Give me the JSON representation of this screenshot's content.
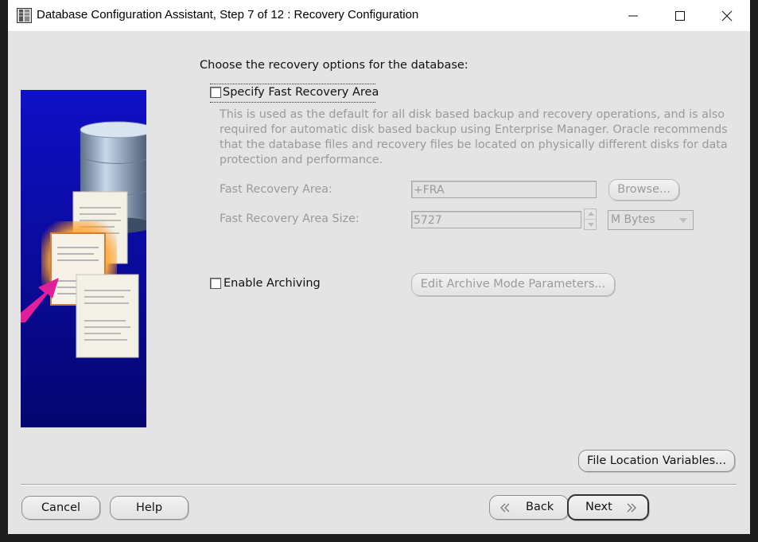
{
  "window": {
    "title": "Database Configuration Assistant, Step 7 of 12 : Recovery Configuration",
    "controls": [
      "minimize-icon",
      "maximize-icon",
      "close-icon"
    ]
  },
  "content": {
    "prompt": "Choose the recovery options for the database:",
    "fast_recovery": {
      "checkbox_label": "Specify Fast Recovery Area",
      "checked": false,
      "description": "This is used as the default for all disk based backup and recovery operations, and is also required for automatic disk based backup using Enterprise Manager. Oracle recommends that the database files and recovery files be located on physically different disks for data protection and performance.",
      "area_label": "Fast Recovery Area:",
      "area_value": "+FRA",
      "browse_label": "Browse...",
      "size_label": "Fast Recovery Area Size:",
      "size_value": "5727",
      "size_unit": "M Bytes"
    },
    "archiving": {
      "checkbox_label": "Enable Archiving",
      "checked": false,
      "edit_params_label": "Edit Archive Mode Parameters..."
    },
    "file_location_label": "File Location Variables..."
  },
  "footer": {
    "cancel_label": "Cancel",
    "help_label": "Help",
    "back_label": "Back",
    "next_label": "Next"
  },
  "colors": {
    "window_bg": "#e4e4e4",
    "disabled_text": "#9a9a9a",
    "image_bg": "#0a0a9c",
    "arrow": "#e0209a"
  }
}
